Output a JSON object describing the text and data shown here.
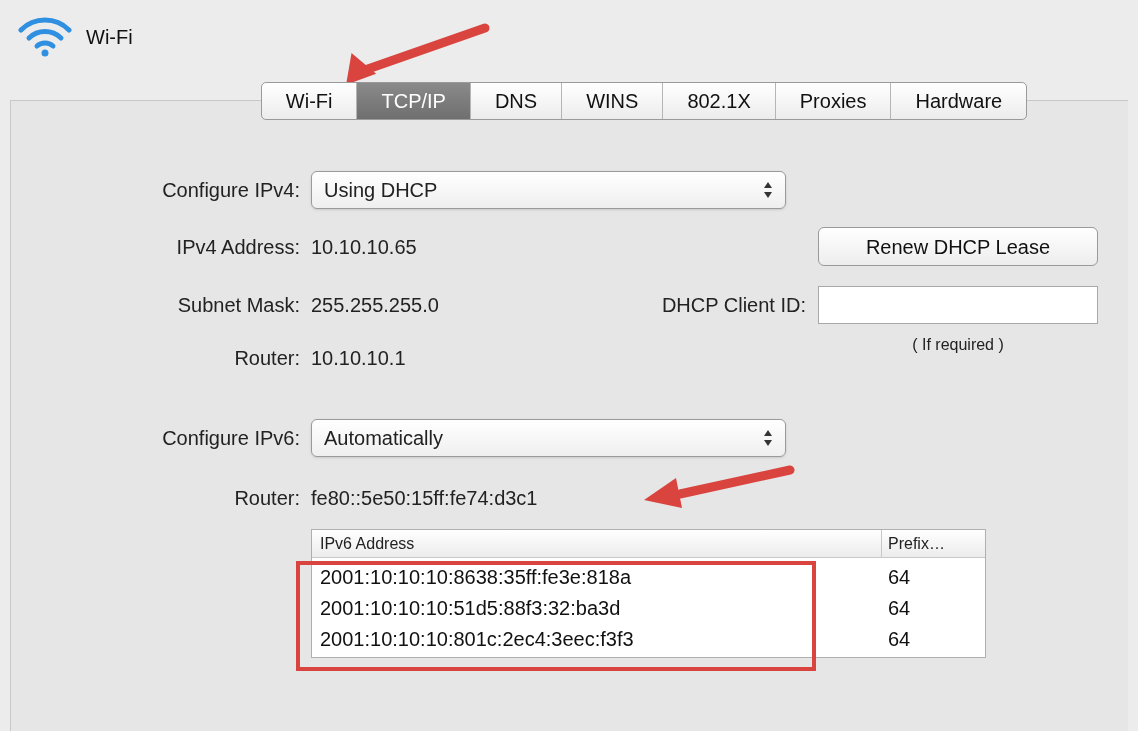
{
  "window": {
    "title": "Wi-Fi"
  },
  "tabs": [
    {
      "label": "Wi-Fi",
      "selected": false
    },
    {
      "label": "TCP/IP",
      "selected": true
    },
    {
      "label": "DNS",
      "selected": false
    },
    {
      "label": "WINS",
      "selected": false
    },
    {
      "label": "802.1X",
      "selected": false
    },
    {
      "label": "Proxies",
      "selected": false
    },
    {
      "label": "Hardware",
      "selected": false
    }
  ],
  "ipv4": {
    "configure_label": "Configure IPv4:",
    "configure_value": "Using DHCP",
    "address_label": "IPv4 Address:",
    "address": "10.10.10.65",
    "subnet_label": "Subnet Mask:",
    "subnet": "255.255.255.0",
    "router_label": "Router:",
    "router": "10.10.10.1"
  },
  "renew_button": "Renew DHCP Lease",
  "dhcp_client_id": {
    "label": "DHCP Client ID:",
    "hint": "( If required )"
  },
  "ipv6": {
    "configure_label": "Configure IPv6:",
    "configure_value": "Automatically",
    "router_label": "Router:",
    "router": "fe80::5e50:15ff:fe74:d3c1"
  },
  "ipv6_table": {
    "columns": [
      "IPv6 Address",
      "Prefix…"
    ],
    "rows": [
      [
        "2001:10:10:10:8638:35ff:fe3e:818a",
        "64"
      ],
      [
        "2001:10:10:10:51d5:88f3:32:ba3d",
        "64"
      ],
      [
        "2001:10:10:10:801c:2ec4:3eec:f3f3",
        "64"
      ]
    ]
  }
}
